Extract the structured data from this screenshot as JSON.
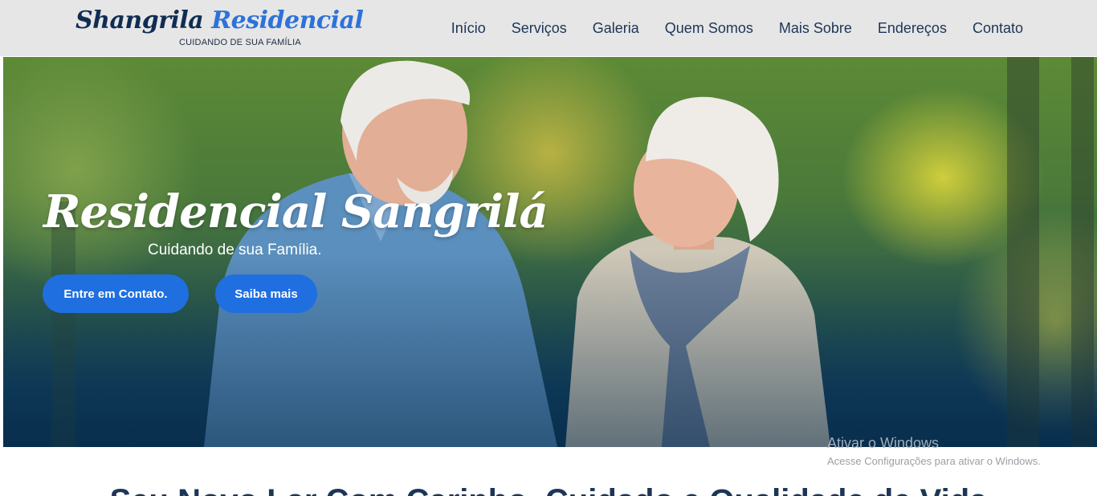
{
  "header": {
    "logo_part1": "Shangrila",
    "logo_part2": "Residencial",
    "logo_tagline": "CUIDANDO DE SUA FAMÍLIA"
  },
  "nav": {
    "items": [
      {
        "label": "Início"
      },
      {
        "label": "Serviços"
      },
      {
        "label": "Galeria"
      },
      {
        "label": "Quem Somos"
      },
      {
        "label": "Mais Sobre"
      },
      {
        "label": "Endereços"
      },
      {
        "label": "Contato"
      }
    ]
  },
  "hero": {
    "title": "Residencial Sangrilá",
    "subtitle": "Cuidando de sua Família.",
    "primary_button": "Entre em Contato.",
    "secondary_button": "Saiba mais"
  },
  "watermark": {
    "title": "Ativar o Windows",
    "subtitle": "Acesse Configurações para ativar o Windows."
  },
  "section": {
    "heading": "Seu Novo Lar Com Carinho, Cuidado e Qualidade de Vida"
  },
  "colors": {
    "header_bg": "#e6e6e6",
    "brand_dark": "#0f2d52",
    "brand_accent": "#2e72d8",
    "button_bg": "#1f6fe0"
  }
}
